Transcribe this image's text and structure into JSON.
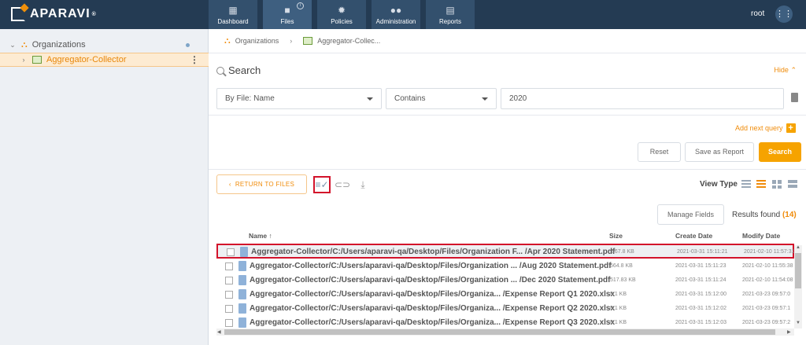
{
  "brand": {
    "name": "APARAVI",
    "mark": "®"
  },
  "nav": [
    {
      "label": "Dashboard",
      "icon": "dashboard-icon"
    },
    {
      "label": "Files",
      "icon": "folder-icon",
      "active": true,
      "info": "i"
    },
    {
      "label": "Policies",
      "icon": "gear-icon"
    },
    {
      "label": "Administration",
      "icon": "users-icon"
    },
    {
      "label": "Reports",
      "icon": "clipboard-icon"
    }
  ],
  "user": {
    "name": "root"
  },
  "sidebar": {
    "items": [
      {
        "label": "Organizations",
        "icon": "organizations-icon"
      },
      {
        "label": "Aggregator-Collector",
        "icon": "collector-icon",
        "selected": true
      }
    ]
  },
  "breadcrumb": [
    "Organizations",
    "Aggregator-Collec..."
  ],
  "search": {
    "title": "Search",
    "hide_label": "Hide",
    "field": "By File: Name",
    "operator": "Contains",
    "value": "2020",
    "add_query": "Add next query",
    "reset": "Reset",
    "save_report": "Save as Report",
    "submit": "Search"
  },
  "toolbar": {
    "return": "RETURN TO FILES",
    "view_type": "View Type",
    "manage_fields": "Manage Fields",
    "results_label": "Results found",
    "results_count": "(14)"
  },
  "table": {
    "columns": [
      "Name",
      "Size",
      "Create Date",
      "Modify Date"
    ],
    "rows": [
      {
        "name": "Aggregator-Collector/C:/Users/aparavi-qa/Desktop/Files/Organization F... /Apr 2020 Statement.pdf",
        "size": "567.8 KB",
        "create": "2021-03-31 15:11:21",
        "modify": "2021-02-10 11:57:31"
      },
      {
        "name": "Aggregator-Collector/C:/Users/aparavi-qa/Desktop/Files/Organization ... /Aug 2020 Statement.pdf",
        "size": "564.8 KB",
        "create": "2021-03-31 15:11:23",
        "modify": "2021-02-10 11:55:38"
      },
      {
        "name": "Aggregator-Collector/C:/Users/aparavi-qa/Desktop/Files/Organization ... /Dec 2020 Statement.pdf",
        "size": "517.83 KB",
        "create": "2021-03-31 15:11:24",
        "modify": "2021-02-10 11:54:08"
      },
      {
        "name": "Aggregator-Collector/C:/Users/aparavi-qa/Desktop/Files/Organiza... /Expense Report Q1 2020.xlsx",
        "size": "8.1 KB",
        "create": "2021-03-31 15:12:00",
        "modify": "2021-03-23 09:57:0"
      },
      {
        "name": "Aggregator-Collector/C:/Users/aparavi-qa/Desktop/Files/Organiza... /Expense Report Q2 2020.xlsx",
        "size": "8.1 KB",
        "create": "2021-03-31 15:12:02",
        "modify": "2021-03-23 09:57:1"
      },
      {
        "name": "Aggregator-Collector/C:/Users/aparavi-qa/Desktop/Files/Organiza... /Expense Report Q3 2020.xlsx",
        "size": "8.1 KB",
        "create": "2021-03-31 15:12:03",
        "modify": "2021-03-23 09:57:2"
      }
    ]
  }
}
